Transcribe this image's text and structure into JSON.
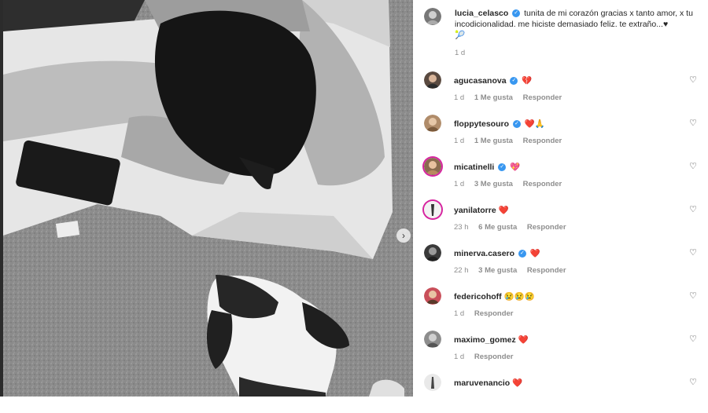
{
  "post": {
    "author": "lucia_celasco",
    "caption": "tunita de mi corazón gracias x tanto amor, x tu incodicionalidad. me hiciste demasiado feliz. te extraño...♥",
    "caption_emoji": "🎾",
    "time": "1 d"
  },
  "comments": [
    {
      "user": "agucasanova",
      "verified": true,
      "text": "💔",
      "time": "1 d",
      "likes": "1 Me gusta",
      "reply": "Responder"
    },
    {
      "user": "floppytesouro",
      "verified": true,
      "text": "❤️🙏",
      "time": "1 d",
      "likes": "1 Me gusta",
      "reply": "Responder"
    },
    {
      "user": "micatinelli",
      "verified": true,
      "text": "💖",
      "time": "1 d",
      "likes": "3 Me gusta",
      "reply": "Responder"
    },
    {
      "user": "yanilatorre",
      "verified": false,
      "text": "❤️",
      "time": "23 h",
      "likes": "6 Me gusta",
      "reply": "Responder"
    },
    {
      "user": "minerva.casero",
      "verified": true,
      "text": "❤️",
      "time": "22 h",
      "likes": "3 Me gusta",
      "reply": "Responder"
    },
    {
      "user": "federicohoff",
      "verified": false,
      "text": "😢😢😢",
      "time": "1 d",
      "likes": "",
      "reply": "Responder"
    },
    {
      "user": "maximo_gomez",
      "verified": false,
      "text": "❤️",
      "time": "1 d",
      "likes": "",
      "reply": "Responder"
    },
    {
      "user": "maruvenancio",
      "verified": false,
      "text": "❤️",
      "time": "",
      "likes": "",
      "reply": ""
    }
  ],
  "icons": {
    "verified": "verified-badge-icon",
    "like": "heart-outline-icon",
    "carousel_next": "chevron-right-icon"
  },
  "colors": {
    "verified": "#3897f0",
    "meta_text": "#8e8e8e",
    "heart_red": "#ed1c24"
  }
}
